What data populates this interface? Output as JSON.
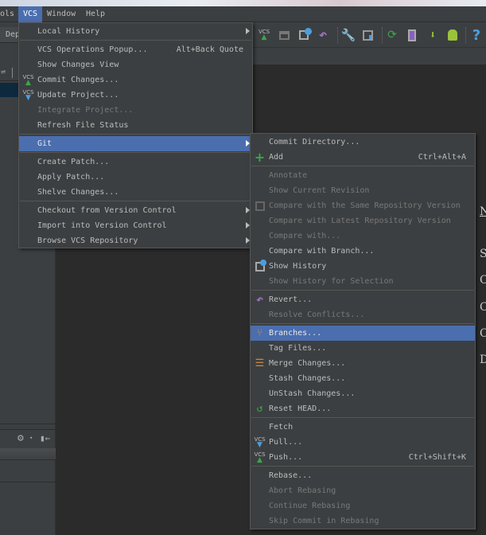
{
  "menubar": {
    "items": [
      {
        "label": "ols"
      },
      {
        "label": "VCS",
        "active": true
      },
      {
        "label": "Window"
      },
      {
        "label": "Help"
      }
    ]
  },
  "left_panel": {
    "tab_label": "Dep"
  },
  "right_panel": {
    "letters": [
      "N",
      "S",
      "C",
      "C",
      "C",
      "D"
    ]
  },
  "toolbar": {
    "icons": [
      "vcs-update-icon",
      "lock-icon",
      "history-icon",
      "revert-icon",
      "wrench-icon",
      "project-structure-icon",
      "sync-icon",
      "avd-manager-icon",
      "sdk-manager-icon",
      "android-icon",
      "help-icon"
    ],
    "help_glyph": "?",
    "vcs_text": "VCS"
  },
  "vcs_menu": {
    "items": [
      {
        "label": "Local History",
        "submenu": true
      },
      {
        "sep": true
      },
      {
        "label": "VCS Operations Popup...",
        "shortcut": "Alt+Back Quote"
      },
      {
        "label": "Show Changes View"
      },
      {
        "label": "Commit Changes...",
        "icon": "vcs-commit-icon"
      },
      {
        "label": "Update Project...",
        "icon": "vcs-update-icon"
      },
      {
        "label": "Integrate Project...",
        "disabled": true
      },
      {
        "label": "Refresh File Status"
      },
      {
        "sep": true
      },
      {
        "label": "Git",
        "submenu": true,
        "highlighted": true
      },
      {
        "sep": true
      },
      {
        "label": "Create Patch..."
      },
      {
        "label": "Apply Patch..."
      },
      {
        "label": "Shelve Changes..."
      },
      {
        "sep": true
      },
      {
        "label": "Checkout from Version Control",
        "submenu": true
      },
      {
        "label": "Import into Version Control",
        "submenu": true
      },
      {
        "label": "Browse VCS Repository",
        "submenu": true
      }
    ]
  },
  "git_menu": {
    "items": [
      {
        "label": "Commit Directory..."
      },
      {
        "label": "Add",
        "shortcut": "Ctrl+Alt+A",
        "icon": "add-icon"
      },
      {
        "sep": true
      },
      {
        "label": "Annotate",
        "disabled": true
      },
      {
        "label": "Show Current Revision",
        "disabled": true
      },
      {
        "label": "Compare with the Same Repository Version",
        "disabled": true,
        "icon": "compare-icon"
      },
      {
        "label": "Compare with Latest Repository Version",
        "disabled": true
      },
      {
        "label": "Compare with...",
        "disabled": true
      },
      {
        "label": "Compare with Branch..."
      },
      {
        "label": "Show History",
        "icon": "history-icon"
      },
      {
        "label": "Show History for Selection",
        "disabled": true
      },
      {
        "sep": true
      },
      {
        "label": "Revert...",
        "icon": "revert-icon"
      },
      {
        "label": "Resolve Conflicts...",
        "disabled": true
      },
      {
        "sep": true
      },
      {
        "label": "Branches...",
        "highlighted": true,
        "icon": "branches-icon"
      },
      {
        "label": "Tag Files..."
      },
      {
        "label": "Merge Changes...",
        "icon": "merge-icon"
      },
      {
        "label": "Stash Changes..."
      },
      {
        "label": "UnStash Changes..."
      },
      {
        "label": "Reset HEAD...",
        "icon": "reset-head-icon"
      },
      {
        "sep": true
      },
      {
        "label": "Fetch"
      },
      {
        "label": "Pull...",
        "icon": "vcs-update-icon"
      },
      {
        "label": "Push...",
        "shortcut": "Ctrl+Shift+K",
        "icon": "vcs-commit-icon"
      },
      {
        "sep": true
      },
      {
        "label": "Rebase..."
      },
      {
        "label": "Abort Rebasing",
        "disabled": true
      },
      {
        "label": "Continue Rebasing",
        "disabled": true
      },
      {
        "label": "Skip Commit in Rebasing",
        "disabled": true
      }
    ]
  },
  "colors": {
    "highlight": "#4b6eaf",
    "menu_bg": "#3c3f41",
    "editor_bg": "#2b2b2b",
    "text": "#bbbbbb",
    "disabled": "#787878"
  }
}
